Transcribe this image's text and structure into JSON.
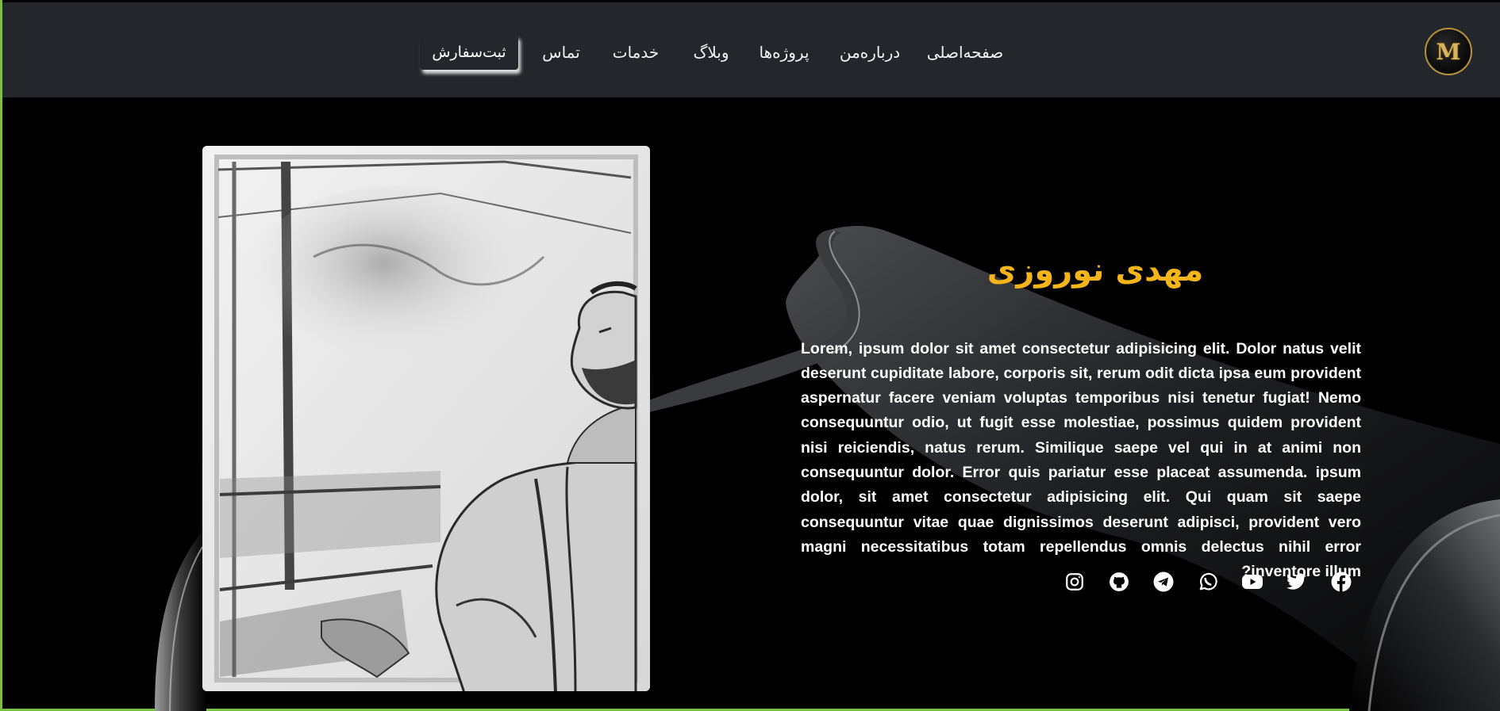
{
  "header": {
    "logo_letter": "M",
    "nav": {
      "home": "صفحه‌اصلی",
      "about": "درباره‌من",
      "projects": "پروژه‌ها",
      "blog": "وبلاگ",
      "services": "خدمات",
      "contact": "تماس",
      "order": "ثبت‌سفارش"
    }
  },
  "hero": {
    "name": "مهدی نوروزی",
    "bio": "Lorem, ipsum dolor sit amet consectetur adipisicing elit. Dolor natus velit deserunt cupiditate labore, corporis sit, rerum odit dicta ipsa eum provident aspernatur facere veniam voluptas temporibus nisi tenetur fugiat! Nemo consequuntur odio, ut fugit esse molestiae, possimus quidem provident nisi reiciendis, natus rerum. Similique saepe vel qui in at animi non consequuntur dolor. Error quis pariatur esse placeat assumenda. ipsum dolor, sit amet consectetur adipisicing elit. Qui quam sit saepe consequuntur vitae quae dignissimos deserunt adipisci, provident vero magni necessitatibus totam repellendus omnis delectus nihil error inventore illum?"
  },
  "social_icons": [
    "instagram-icon",
    "github-icon",
    "telegram-icon",
    "whatsapp-icon",
    "youtube-icon",
    "twitter-icon",
    "facebook-icon"
  ],
  "colors": {
    "header_bg": "#23262b",
    "accent_name": "#f4b41a",
    "logo_gold": "#b8923a",
    "edge_green": "#7bc043"
  }
}
